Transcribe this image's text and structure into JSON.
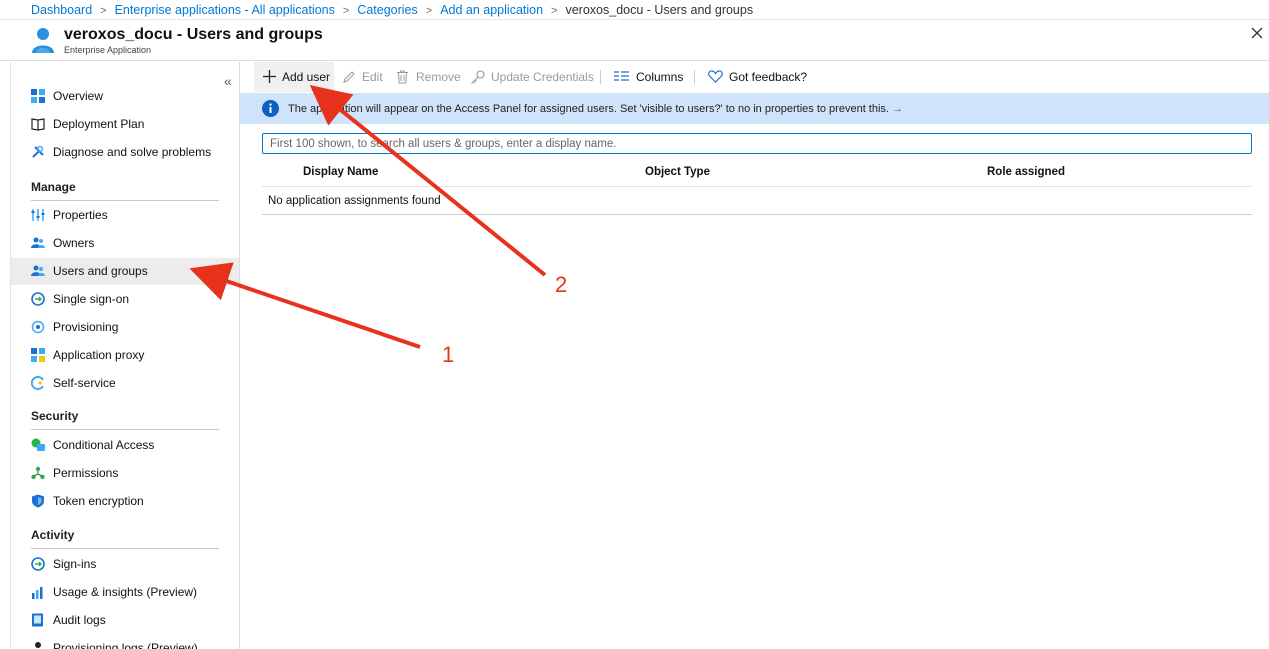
{
  "breadcrumb": {
    "items": [
      "Dashboard",
      "Enterprise applications - All applications",
      "Categories",
      "Add an application"
    ],
    "current": "veroxos_docu - Users and groups"
  },
  "header": {
    "title": "veroxos_docu - Users and groups",
    "subtitle": "Enterprise Application",
    "icon": "user-icon",
    "close_icon": "close-icon"
  },
  "sidebar": {
    "collapse": "«",
    "items": [
      {
        "label": "Overview",
        "icon": "grid-icon"
      },
      {
        "label": "Deployment Plan",
        "icon": "book-icon"
      },
      {
        "label": "Diagnose and solve problems",
        "icon": "wrench-icon"
      }
    ],
    "sections": [
      {
        "title": "Manage",
        "items": [
          {
            "label": "Properties",
            "icon": "sliders-icon"
          },
          {
            "label": "Owners",
            "icon": "people-icon"
          },
          {
            "label": "Users and groups",
            "icon": "people-icon",
            "active": true
          },
          {
            "label": "Single sign-on",
            "icon": "sso-icon"
          },
          {
            "label": "Provisioning",
            "icon": "provisioning-icon"
          },
          {
            "label": "Application proxy",
            "icon": "proxy-icon"
          },
          {
            "label": "Self-service",
            "icon": "self-service-icon"
          }
        ]
      },
      {
        "title": "Security",
        "items": [
          {
            "label": "Conditional Access",
            "icon": "conditional-access-icon"
          },
          {
            "label": "Permissions",
            "icon": "permissions-icon"
          },
          {
            "label": "Token encryption",
            "icon": "shield-icon"
          }
        ]
      },
      {
        "title": "Activity",
        "items": [
          {
            "label": "Sign-ins",
            "icon": "sign-in-icon"
          },
          {
            "label": "Usage & insights (Preview)",
            "icon": "chart-icon"
          },
          {
            "label": "Audit logs",
            "icon": "log-icon"
          },
          {
            "label": "Provisioning logs (Preview)",
            "icon": "person-icon"
          }
        ]
      }
    ]
  },
  "toolbar": {
    "add_user": "Add user",
    "edit": "Edit",
    "remove": "Remove",
    "update_credentials": "Update Credentials",
    "columns": "Columns",
    "feedback": "Got feedback?"
  },
  "banner": {
    "message": "The application will appear on the Access Panel for assigned users. Set 'visible to users?' to no in properties to prevent this.",
    "arrow": "→"
  },
  "search": {
    "placeholder": "First 100 shown, to search all users & groups, enter a display name.",
    "value": ""
  },
  "table": {
    "columns": [
      "Display Name",
      "Object Type",
      "Role assigned"
    ],
    "empty_message": "No application assignments found"
  },
  "annotations": {
    "arrow1_label": "1",
    "arrow2_label": "2",
    "arrow_color": "#e8331c"
  },
  "colors": {
    "accent": "#0078d4",
    "banner_bg": "#cfe4fa",
    "active_nav_bg": "#ececec"
  }
}
